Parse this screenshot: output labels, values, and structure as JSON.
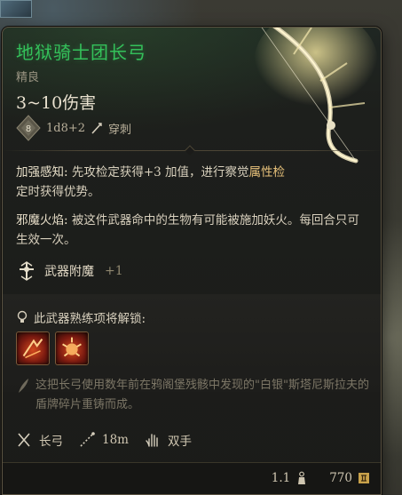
{
  "item": {
    "name": "地狱骑士团长弓",
    "rarity": "精良",
    "damage": "3~10伤害",
    "dice_badge": "8",
    "dice_formula": "1d8+2",
    "damage_type": "穿刺"
  },
  "passives": [
    {
      "name": "加强感知:",
      "text_before": " 先攻检定获得+3 加值，进行察觉",
      "highlight": "属性检",
      "text_after": "定时获得优势。",
      "highlight2": "优势"
    },
    {
      "name": "邪魔火焰:",
      "text": " 被这件武器命中的生物有可能被施加妖火。每回合只可生效一次。"
    }
  ],
  "enchant": {
    "label": "武器附魔",
    "bonus": "+1",
    "icon": "weapon-enchant-icon"
  },
  "unlock": {
    "title": "此武器熟练项将解锁:",
    "skills": [
      "flame-slash-skill-icon",
      "fire-burst-skill-icon"
    ]
  },
  "lore": "这把长弓使用数年前在鸦阁堡残骸中发现的\"白银\"斯塔尼斯拉夫的盾牌碎片重铸而成。",
  "properties": [
    {
      "icon": "bow-icon",
      "label": "长弓"
    },
    {
      "icon": "range-icon",
      "label": "18m"
    },
    {
      "icon": "hand-icon",
      "label": "双手"
    }
  ],
  "footer": {
    "weight": "1.1",
    "value": "770"
  },
  "colors": {
    "name_green": "#34c05a",
    "highlight_gold": "#e6c07a",
    "text": "#d8d0bd"
  }
}
